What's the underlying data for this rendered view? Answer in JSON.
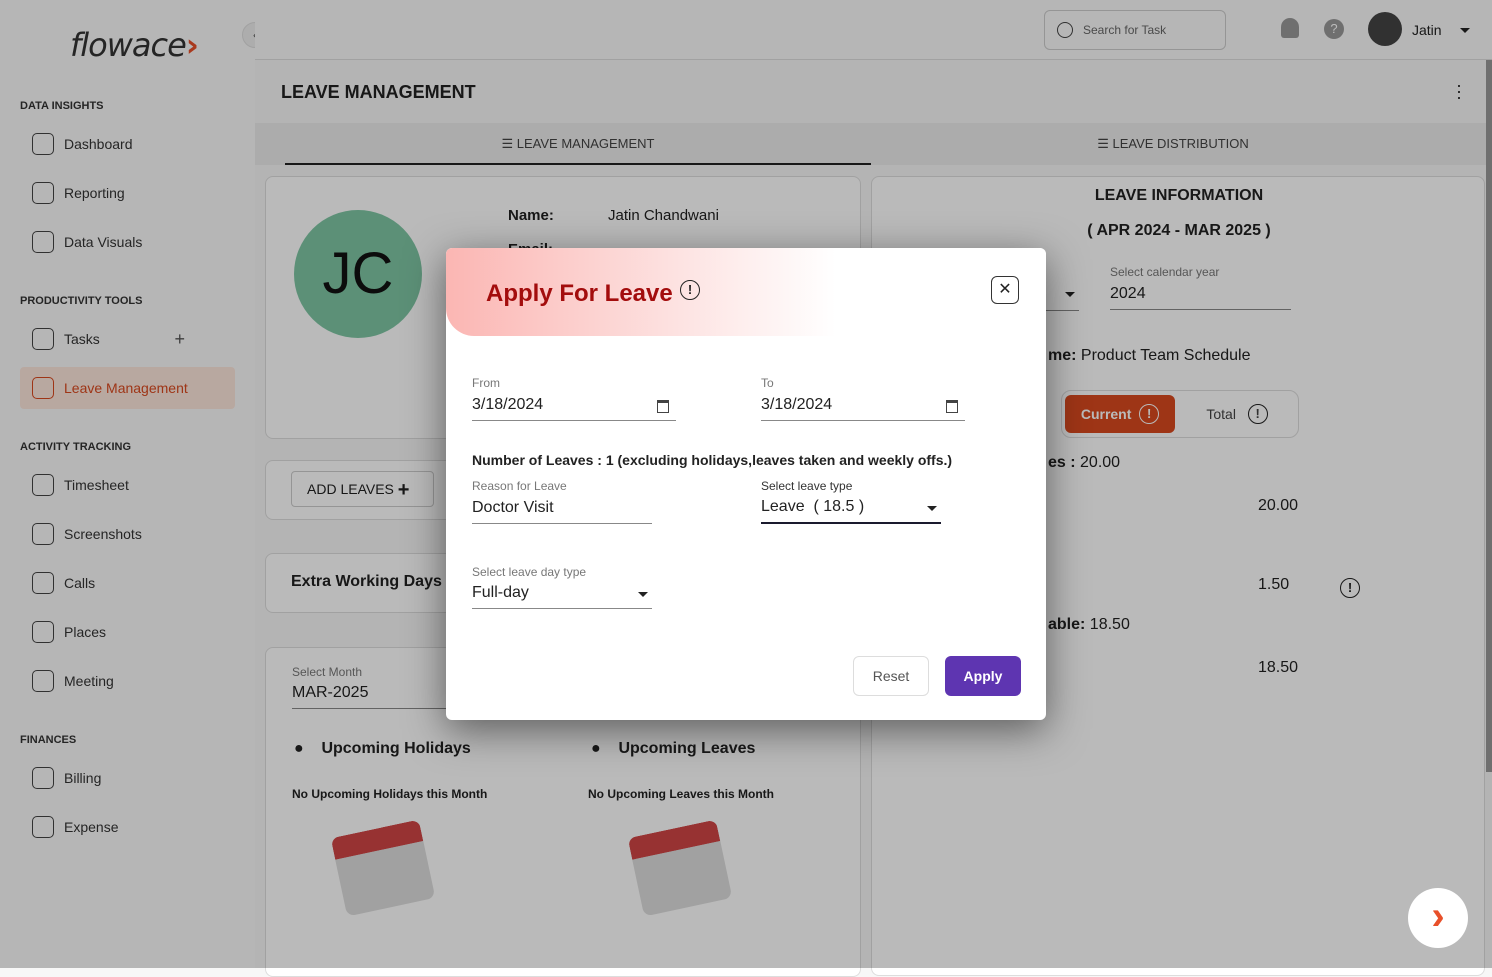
{
  "app": {
    "logo": "flowace",
    "user": "Jatin",
    "search_placeholder": "Search for Task"
  },
  "sidebar": {
    "sections": [
      {
        "title": "DATA INSIGHTS",
        "items": [
          "Dashboard",
          "Reporting",
          "Data Visuals"
        ]
      },
      {
        "title": "PRODUCTIVITY TOOLS",
        "items": [
          "Tasks",
          "Leave Management"
        ]
      },
      {
        "title": "ACTIVITY TRACKING",
        "items": [
          "Timesheet",
          "Screenshots",
          "Calls",
          "Places",
          "Meeting"
        ]
      },
      {
        "title": "FINANCES",
        "items": [
          "Billing",
          "Expense"
        ]
      }
    ],
    "active": "Leave Management"
  },
  "page": {
    "title": "LEAVE MANAGEMENT",
    "tabs": [
      "LEAVE MANAGEMENT",
      "LEAVE DISTRIBUTION"
    ]
  },
  "profile": {
    "initials": "JC",
    "name_label": "Name:",
    "name": "Jatin Chandwani",
    "email_label": "Email:"
  },
  "add_leaves": "ADD LEAVES",
  "extra_working_days": "Extra Working Days :",
  "month": {
    "label": "Select Month",
    "value": "MAR-2025"
  },
  "upcoming": {
    "holidays_title": "Upcoming Holidays",
    "holidays_empty": "No Upcoming Holidays this Month",
    "leaves_title": "Upcoming Leaves",
    "leaves_empty": "No Upcoming Leaves this Month"
  },
  "leave_info": {
    "title": "LEAVE INFORMATION",
    "period": "( APR  2024  - MAR  2025 )",
    "year_label": "Select calendar year",
    "year": "2024",
    "schedule_fragment": "me:",
    "schedule": "Product Team Schedule",
    "toggle": [
      "Current",
      "Total"
    ],
    "total_fragment": "es :",
    "total_value": "20.00",
    "available_fragment": "able:",
    "available_value": "18.50",
    "col_values": [
      "20.00",
      "1.50",
      "18.50"
    ]
  },
  "modal": {
    "title": "Apply For Leave",
    "from_label": "From",
    "from": "3/18/2024",
    "to_label": "To",
    "to": "3/18/2024",
    "count_note": "Number of Leaves : 1 (excluding holidays,leaves taken and weekly offs.)",
    "reason_label": "Reason for Leave",
    "reason": "Doctor Visit",
    "type_label": "Select leave type",
    "type": "Leave  ( 18.5 )",
    "day_type_label": "Select leave day type",
    "day_type": "Full-day",
    "reset": "Reset",
    "apply": "Apply"
  },
  "colors": {
    "accent": "#d9491f",
    "apply": "#5e35b1",
    "title_red": "#a30d0d"
  }
}
